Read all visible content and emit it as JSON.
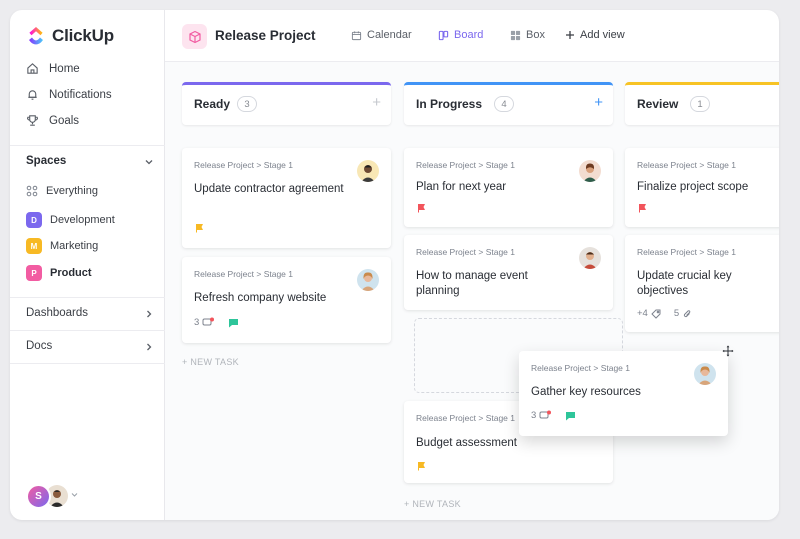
{
  "app": {
    "name": "ClickUp"
  },
  "sidebar": {
    "nav": [
      {
        "label": "Home",
        "icon": "home-icon"
      },
      {
        "label": "Notifications",
        "icon": "bell-icon"
      },
      {
        "label": "Goals",
        "icon": "trophy-icon"
      }
    ],
    "spaces_title": "Spaces",
    "everything_label": "Everything",
    "spaces": [
      {
        "initial": "D",
        "label": "Development",
        "color": "#7b68ee"
      },
      {
        "initial": "M",
        "label": "Marketing",
        "color": "#f7b924"
      },
      {
        "initial": "P",
        "label": "Product",
        "color": "#f25ca2"
      }
    ],
    "dashboards_label": "Dashboards",
    "docs_label": "Docs",
    "user_initial": "S"
  },
  "header": {
    "project_title": "Release Project",
    "views": [
      {
        "label": "Calendar",
        "icon": "calendar-icon",
        "active": false
      },
      {
        "label": "Board",
        "icon": "board-icon",
        "active": true
      },
      {
        "label": "Box",
        "icon": "box-icon",
        "active": false
      }
    ],
    "add_view_label": "Add view"
  },
  "board": {
    "new_task_label": "+ NEW TASK",
    "columns": [
      {
        "name": "Ready",
        "count": "3",
        "color": "#7b68ee"
      },
      {
        "name": "In Progress",
        "count": "4",
        "color": "#4194f6"
      },
      {
        "name": "Review",
        "count": "1",
        "color": "#f7c325"
      }
    ],
    "cards": {
      "ready_1": {
        "crumb": "Release Project > Stage 1",
        "title": "Update contractor agreement",
        "flag_color": "#f7b924"
      },
      "ready_2": {
        "crumb": "Release Project > Stage 1",
        "title": "Refresh company website",
        "comments": "3"
      },
      "progress_1": {
        "crumb": "Release Project > Stage 1",
        "title": "Plan for next year",
        "flag_color": "#f2545b"
      },
      "progress_2": {
        "crumb": "Release Project > Stage 1",
        "title": "How to manage event planning"
      },
      "progress_3": {
        "crumb": "Release Project > Stage 1",
        "title": "Budget assessment",
        "flag_color": "#f7b924"
      },
      "review_1": {
        "crumb": "Release Project > Stage 1",
        "title": "Finalize project scope",
        "flag_color": "#f2545b"
      },
      "review_2": {
        "crumb": "Release Project > Stage 1",
        "title": "Update crucial key objectives",
        "tags": "+4",
        "attachments": "5"
      },
      "dragging": {
        "crumb": "Release Project > Stage 1",
        "title": "Gather key resources",
        "comments": "3"
      }
    }
  }
}
